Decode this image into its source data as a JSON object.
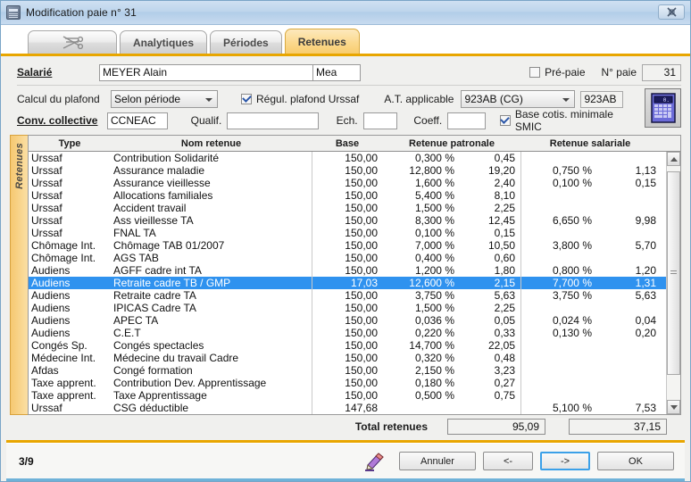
{
  "window": {
    "title": "Modification paie n° 31",
    "icon": "app-icon",
    "close_label": "✕"
  },
  "tabs": [
    {
      "id": "scissors",
      "label": "",
      "icon": "scissors-icon",
      "active": false
    },
    {
      "id": "analytiques",
      "label": "Analytiques",
      "active": false
    },
    {
      "id": "periodes",
      "label": "Périodes",
      "active": false
    },
    {
      "id": "retenues",
      "label": "Retenues",
      "active": true
    }
  ],
  "form": {
    "salarie_label": "Salarié",
    "salarie_value": "MEYER Alain",
    "salarie_code": "Mea",
    "prepaie_label": "Pré-paie",
    "prepaie_checked": false,
    "no_paie_label": "N° paie",
    "no_paie_value": "31",
    "calcul_plafond_label": "Calcul du plafond",
    "calcul_plafond_value": "Selon période",
    "regul_plafond_label": "Régul. plafond Urssaf",
    "regul_plafond_checked": true,
    "at_applicable_label": "A.T. applicable",
    "at_applicable_value": "923AB (CG)",
    "at_code_value": "923AB",
    "conv_collective_label": "Conv. collective",
    "conv_collective_value": "CCNEAC",
    "qualif_label": "Qualif.",
    "qualif_value": "",
    "ech_label": "Ech.",
    "ech_value": "",
    "coeff_label": "Coeff.",
    "coeff_value": "",
    "base_smic_label": "Base cotis. minimale SMIC",
    "base_smic_checked": true,
    "calculator_icon": "calculator-icon"
  },
  "grid": {
    "vertical_tab_label": "Retenues",
    "headers": {
      "type": "Type",
      "nom": "Nom retenue",
      "base": "Base",
      "patronale": "Retenue patronale",
      "salariale": "Retenue salariale"
    },
    "rows": [
      {
        "type": "Urssaf",
        "nom": "Contribution Solidarité",
        "base": "150,00",
        "pct_p": "0,300 %",
        "val_p": "0,45",
        "pct_s": "",
        "val_s": "",
        "selected": false
      },
      {
        "type": "Urssaf",
        "nom": "Assurance maladie",
        "base": "150,00",
        "pct_p": "12,800 %",
        "val_p": "19,20",
        "pct_s": "0,750 %",
        "val_s": "1,13",
        "selected": false
      },
      {
        "type": "Urssaf",
        "nom": "Assurance vieillesse",
        "base": "150,00",
        "pct_p": "1,600 %",
        "val_p": "2,40",
        "pct_s": "0,100 %",
        "val_s": "0,15",
        "selected": false
      },
      {
        "type": "Urssaf",
        "nom": "Allocations familiales",
        "base": "150,00",
        "pct_p": "5,400 %",
        "val_p": "8,10",
        "pct_s": "",
        "val_s": "",
        "selected": false
      },
      {
        "type": "Urssaf",
        "nom": "Accident travail",
        "base": "150,00",
        "pct_p": "1,500 %",
        "val_p": "2,25",
        "pct_s": "",
        "val_s": "",
        "selected": false
      },
      {
        "type": "Urssaf",
        "nom": "Ass vieillesse TA",
        "base": "150,00",
        "pct_p": "8,300 %",
        "val_p": "12,45",
        "pct_s": "6,650 %",
        "val_s": "9,98",
        "selected": false
      },
      {
        "type": "Urssaf",
        "nom": "FNAL TA",
        "base": "150,00",
        "pct_p": "0,100 %",
        "val_p": "0,15",
        "pct_s": "",
        "val_s": "",
        "selected": false
      },
      {
        "type": "Chômage Int.",
        "nom": "Chômage TAB 01/2007",
        "base": "150,00",
        "pct_p": "7,000 %",
        "val_p": "10,50",
        "pct_s": "3,800 %",
        "val_s": "5,70",
        "selected": false
      },
      {
        "type": "Chômage Int.",
        "nom": "AGS TAB",
        "base": "150,00",
        "pct_p": "0,400 %",
        "val_p": "0,60",
        "pct_s": "",
        "val_s": "",
        "selected": false
      },
      {
        "type": "Audiens",
        "nom": "AGFF cadre int TA",
        "base": "150,00",
        "pct_p": "1,200 %",
        "val_p": "1,80",
        "pct_s": "0,800 %",
        "val_s": "1,20",
        "selected": false
      },
      {
        "type": "Audiens",
        "nom": "Retraite cadre TB / GMP",
        "base": "17,03",
        "pct_p": "12,600 %",
        "val_p": "2,15",
        "pct_s": "7,700 %",
        "val_s": "1,31",
        "selected": true
      },
      {
        "type": "Audiens",
        "nom": "Retraite cadre TA",
        "base": "150,00",
        "pct_p": "3,750 %",
        "val_p": "5,63",
        "pct_s": "3,750 %",
        "val_s": "5,63",
        "selected": false
      },
      {
        "type": "Audiens",
        "nom": "IPICAS Cadre TA",
        "base": "150,00",
        "pct_p": "1,500 %",
        "val_p": "2,25",
        "pct_s": "",
        "val_s": "",
        "selected": false
      },
      {
        "type": "Audiens",
        "nom": "APEC TA",
        "base": "150,00",
        "pct_p": "0,036 %",
        "val_p": "0,05",
        "pct_s": "0,024 %",
        "val_s": "0,04",
        "selected": false
      },
      {
        "type": "Audiens",
        "nom": "C.E.T",
        "base": "150,00",
        "pct_p": "0,220 %",
        "val_p": "0,33",
        "pct_s": "0,130 %",
        "val_s": "0,20",
        "selected": false
      },
      {
        "type": "Congés Sp.",
        "nom": "Congés spectacles",
        "base": "150,00",
        "pct_p": "14,700 %",
        "val_p": "22,05",
        "pct_s": "",
        "val_s": "",
        "selected": false
      },
      {
        "type": "Médecine Int.",
        "nom": "Médecine du travail Cadre",
        "base": "150,00",
        "pct_p": "0,320 %",
        "val_p": "0,48",
        "pct_s": "",
        "val_s": "",
        "selected": false
      },
      {
        "type": "Afdas",
        "nom": "Congé formation",
        "base": "150,00",
        "pct_p": "2,150 %",
        "val_p": "3,23",
        "pct_s": "",
        "val_s": "",
        "selected": false
      },
      {
        "type": "Taxe apprent.",
        "nom": "Contribution Dev. Apprentissage",
        "base": "150,00",
        "pct_p": "0,180 %",
        "val_p": "0,27",
        "pct_s": "",
        "val_s": "",
        "selected": false
      },
      {
        "type": "Taxe apprent.",
        "nom": "Taxe Apprentissage",
        "base": "150,00",
        "pct_p": "0,500 %",
        "val_p": "0,75",
        "pct_s": "",
        "val_s": "",
        "selected": false
      },
      {
        "type": "Urssaf",
        "nom": "CSG déductible",
        "base": "147,68",
        "pct_p": "",
        "val_p": "",
        "pct_s": "5,100 %",
        "val_s": "7,53",
        "selected": false
      }
    ]
  },
  "totals": {
    "label": "Total retenues",
    "patronale": "95,09",
    "salariale": "37,15"
  },
  "footer": {
    "pager": "3/9",
    "pencil_icon": "pencil-icon",
    "cancel_label": "Annuler",
    "prev_label": "<-",
    "next_label": "->",
    "ok_label": "OK"
  },
  "colors": {
    "accent": "#e8a600",
    "selection": "#2f92ef",
    "tab_active": "#fbd98e",
    "title_bar": "#bed5ec"
  }
}
